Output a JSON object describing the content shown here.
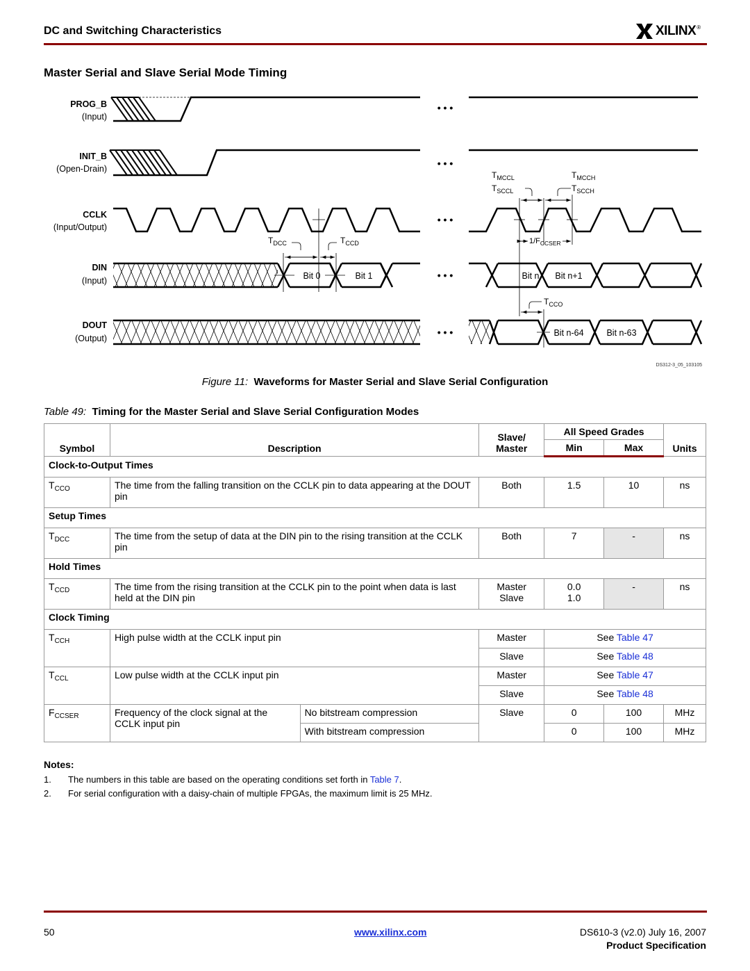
{
  "header": {
    "section": "DC and Switching Characteristics",
    "logo_text": "XILINX",
    "logo_reg": "®"
  },
  "section_title": "Master Serial and Slave Serial Mode Timing",
  "figure": {
    "signals": [
      {
        "name": "PROG_B",
        "dir": "(Input)"
      },
      {
        "name": "INIT_B",
        "dir": "(Open-Drain)"
      },
      {
        "name": "CCLK",
        "dir": "(Input/Output)"
      },
      {
        "name": "DIN",
        "dir": "(Input)"
      },
      {
        "name": "DOUT",
        "dir": "(Output)"
      }
    ],
    "din_bits": [
      "Bit 0",
      "Bit 1",
      "Bit n",
      "Bit n+1"
    ],
    "dout_bits": [
      "Bit n-64",
      "Bit n-63"
    ],
    "annotations": {
      "tdcc": {
        "main": "T",
        "sub": "DCC"
      },
      "tccd": {
        "main": "T",
        "sub": "CCD"
      },
      "tmccl": {
        "main": "T",
        "sub": "MCCL"
      },
      "tsccl": {
        "main": "T",
        "sub": "SCCL"
      },
      "tmcch": {
        "main": "T",
        "sub": "MCCH"
      },
      "tscch": {
        "main": "T",
        "sub": "SCCH"
      },
      "fccser": {
        "main": "1/F",
        "sub": "CCSER"
      },
      "tcco": {
        "main": "T",
        "sub": "CCO"
      }
    },
    "ellipsis": "• • •",
    "figure_id": "DS312-3_05_103105",
    "caption_label": "Figure 11:",
    "caption_text": "Waveforms for Master Serial and Slave Serial Configuration"
  },
  "table": {
    "caption_label": "Table  49:",
    "caption_text": "Timing for the Master Serial and Slave Serial Configuration Modes",
    "headers": {
      "symbol": "Symbol",
      "description": "Description",
      "slave_master": "Slave/ Master",
      "speed_grades": "All Speed Grades",
      "min": "Min",
      "max": "Max",
      "units": "Units"
    },
    "sections": {
      "clock_to_output": "Clock-to-Output Times",
      "setup": "Setup Times",
      "hold": "Hold Times",
      "clock_timing": "Clock Timing"
    },
    "rows": {
      "tcco": {
        "sym": "T",
        "sub": "CCO",
        "desc": "The time from the falling transition on the CCLK pin to data appearing at the DOUT pin",
        "mode": "Both",
        "min": "1.5",
        "max": "10",
        "units": "ns"
      },
      "tdcc": {
        "sym": "T",
        "sub": "DCC",
        "desc": "The time from the setup of data at the DIN pin to the rising transition at the CCLK pin",
        "mode": "Both",
        "min": "7",
        "max": "-",
        "units": "ns"
      },
      "tccd": {
        "sym": "T",
        "sub": "CCD",
        "desc": "The time from the rising transition at the CCLK pin to the point when data is last held at the DIN pin",
        "mode1": "Master",
        "mode2": "Slave",
        "min1": "0.0",
        "min2": "1.0",
        "max": "-",
        "units": "ns"
      },
      "tcch": {
        "sym": "T",
        "sub": "CCH",
        "desc": "High pulse width at the CCLK input pin",
        "mode1": "Master",
        "ref1_pre": "See ",
        "ref1_link": "Table 47",
        "mode2": "Slave",
        "ref2_pre": "See ",
        "ref2_link": "Table 48"
      },
      "tccl": {
        "sym": "T",
        "sub": "CCL",
        "desc": "Low pulse width at the CCLK input pin",
        "mode1": "Master",
        "ref1_pre": "See ",
        "ref1_link": "Table 47",
        "mode2": "Slave",
        "ref2_pre": "See ",
        "ref2_link": "Table 48"
      },
      "fccser": {
        "sym": "F",
        "sub": "CCSER",
        "desc": "Frequency of the clock signal at the CCLK input pin",
        "cond1": "No bitstream compression",
        "cond2": "With bitstream compression",
        "mode": "Slave",
        "min1": "0",
        "max1": "100",
        "units1": "MHz",
        "min2": "0",
        "max2": "100",
        "units2": "MHz"
      }
    }
  },
  "notes": {
    "title": "Notes:",
    "items": [
      {
        "num": "1.",
        "text": "The numbers in this table are based on the operating conditions set forth in ",
        "link": "Table 7",
        "after": "."
      },
      {
        "num": "2.",
        "text": "For serial configuration with a daisy-chain of multiple FPGAs, the maximum limit is 25 MHz."
      }
    ]
  },
  "footer": {
    "page": "50",
    "url": "www.xilinx.com",
    "doc": "DS610-3 (v2.0) July 16, 2007",
    "spec": "Product Specification"
  }
}
